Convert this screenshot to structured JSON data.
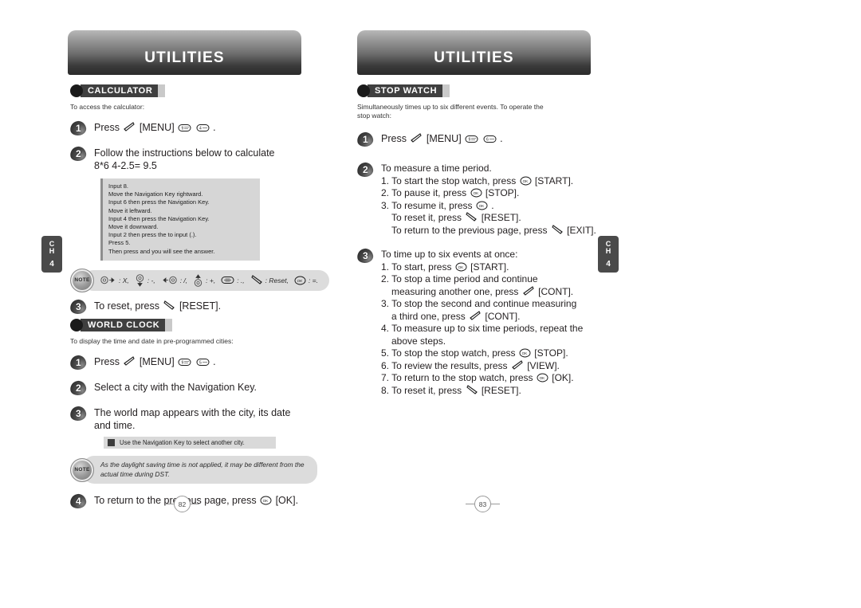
{
  "left_page": {
    "banner_title": "UTILITIES",
    "chapter_tab": {
      "ch": "C",
      "h": "H",
      "number": "4"
    },
    "page_number": "82",
    "sections": [
      {
        "badge": "CALCULATOR",
        "lead": "To access the calculator:",
        "steps": [
          {
            "num": "1",
            "text_before": "Press",
            "menu": "[MENU]",
            "text_after": "."
          },
          {
            "num": "2",
            "line1": "Follow the instructions below to calculate",
            "line2": "8*6  4-2.5= 9.5"
          },
          {
            "num": "3",
            "text_before": "To reset, press",
            "text_after": "[RESET]."
          }
        ],
        "codebox": [
          "Input 8.",
          "Move the Navigation Key rightward.",
          "Input 6 then press the Navigation Key.",
          "Move it leftward.",
          "Input 4 then press the Navigation Key.",
          "Move it downward.",
          "Input 2 then press the        to input (.).",
          "Press 5.",
          "Then press        and you will see the answer."
        ],
        "legend": {
          "note_label": "NOTE",
          "items": [
            {
              "icon": "nav-right-icon",
              "label": ": X,"
            },
            {
              "icon": "nav-down-icon",
              "label": ": -,"
            },
            {
              "icon": "nav-left-icon",
              "label": ": /,"
            },
            {
              "icon": "nav-up-icon",
              "label": ": +,"
            },
            {
              "icon": "star-key-icon",
              "label": ": .,"
            },
            {
              "icon": "softkey-right-icon",
              "label": ": Reset,"
            },
            {
              "icon": "ok-key-icon",
              "label": ": =."
            }
          ]
        }
      },
      {
        "badge": "WORLD CLOCK",
        "lead": "To display the time and date in pre-programmed cities:",
        "steps": [
          {
            "num": "1",
            "text_before": "Press",
            "menu": "[MENU]",
            "text_after": "."
          },
          {
            "num": "2",
            "line1": "Select a city with the Navigation Key."
          },
          {
            "num": "3",
            "line1": "The world map appears with the city, its date",
            "line2": "and time."
          },
          {
            "num": "4",
            "text_before": "To return to the previous page, press",
            "text_after": "[OK]."
          }
        ],
        "tip": "Use the Navigation Key to select another city.",
        "note": "As the daylight saving time is not applied, it may be different from the actual time during DST.",
        "note_label": "NOTE"
      }
    ]
  },
  "right_page": {
    "banner_title": "UTILITIES",
    "chapter_tab": {
      "ch": "C",
      "h": "H",
      "number": "4"
    },
    "page_number": "83",
    "section": {
      "badge": "STOP WATCH",
      "lead": "Simultaneously times up to six different events. To operate the stop watch:",
      "step1": {
        "num": "1",
        "text_before": "Press",
        "menu": "[MENU]",
        "text_after": "."
      },
      "step2": {
        "num": "2",
        "title": "To measure a time period.",
        "lines": [
          {
            "prefix": "1. To start the stop watch, press",
            "icon": "ok-key-icon",
            "suffix": "[START]."
          },
          {
            "prefix": "2. To pause it, press",
            "icon": "ok-key-icon",
            "suffix": "[STOP]."
          },
          {
            "prefix": "3. To resume it, press",
            "icon": "ok-key-icon",
            "suffix": "."
          },
          {
            "prefix": "To reset it, press",
            "icon": "softkey-right-icon",
            "suffix": "[RESET].",
            "indent": true
          },
          {
            "prefix": "To return to the previous page, press",
            "icon": "softkey-right-icon",
            "suffix": "[EXIT].",
            "indent": true
          }
        ]
      },
      "step3": {
        "num": "3",
        "title": "To time up to six events at once:",
        "lines": [
          {
            "prefix": "1. To start, press",
            "icon": "ok-key-icon",
            "suffix": "[START]."
          },
          {
            "prefix": "2. To stop a time period and continue",
            "icon": "",
            "suffix": ""
          },
          {
            "prefix": "measuring another one, press",
            "icon": "softkey-left-icon",
            "suffix": "[CONT].",
            "indent": true
          },
          {
            "prefix": "3. To stop the second and continue measuring",
            "icon": "",
            "suffix": ""
          },
          {
            "prefix": "a third one, press",
            "icon": "softkey-left-icon",
            "suffix": "[CONT].",
            "indent": true
          },
          {
            "prefix": "4. To measure up to six time periods, repeat the",
            "icon": "",
            "suffix": ""
          },
          {
            "prefix": "above steps.",
            "icon": "",
            "suffix": "",
            "indent": true
          },
          {
            "prefix": "5. To stop the stop watch, press",
            "icon": "ok-key-icon",
            "suffix": "[STOP]."
          },
          {
            "prefix": "6. To review the results, press",
            "icon": "softkey-left-icon",
            "suffix": "[VIEW]."
          },
          {
            "prefix": "7. To return to the stop watch, press",
            "icon": "ok-key-icon",
            "suffix": "[OK]."
          },
          {
            "prefix": "8. To reset it, press",
            "icon": "softkey-right-icon",
            "suffix": "[RESET]."
          }
        ]
      }
    }
  },
  "keys": {
    "menu_softkey": "softkey-left-icon",
    "calc_keys": [
      "9-key-icon",
      "4-key-icon"
    ],
    "clock_keys": [
      "9-key-icon",
      "5-key-icon"
    ],
    "watch_keys": [
      "9-key-icon",
      "6-key-icon"
    ],
    "labels": {
      "nine": "9",
      "four": "4",
      "five": "5",
      "six": "6",
      "ok": "OK"
    }
  }
}
